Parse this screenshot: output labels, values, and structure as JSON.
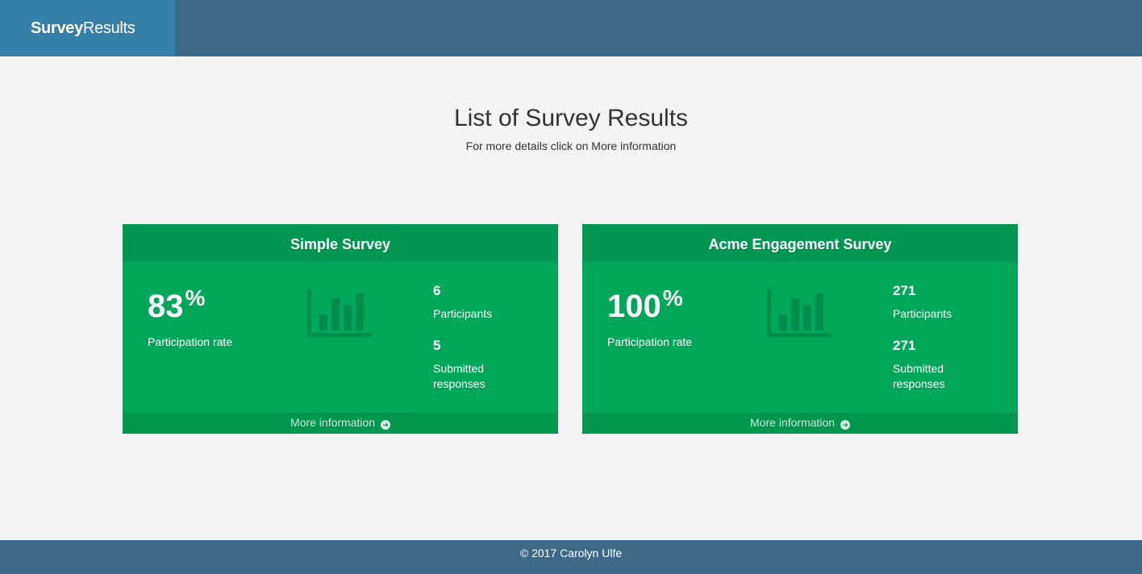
{
  "navbar": {
    "brand_bold": "Survey",
    "brand_light": "Results"
  },
  "main": {
    "title": "List of Survey Results",
    "subtitle": "For more details click on More information"
  },
  "surveys": [
    {
      "name": "Simple Survey",
      "rate": "83",
      "rate_unit": "%",
      "rate_label": "Participation rate",
      "participants": "6",
      "participants_label": "Participants",
      "submitted": "5",
      "submitted_label": "Submitted responses",
      "more_label": "More information",
      "icon": "bar-chart-icon"
    },
    {
      "name": "Acme Engagement Survey",
      "rate": "100",
      "rate_unit": "%",
      "rate_label": "Participation rate",
      "participants": "271",
      "participants_label": "Participants",
      "submitted": "271",
      "submitted_label": "Submitted responses",
      "more_label": "More information",
      "icon": "bar-chart-icon"
    }
  ],
  "footer": {
    "text": "© 2017 Carolyn Ulfe"
  },
  "colors": {
    "navbar": "#3c6a89",
    "brand": "#367fa9",
    "card": "#00a65a",
    "card_header": "#009551",
    "card_footer": "#00964f",
    "background": "#f4f4f4"
  }
}
